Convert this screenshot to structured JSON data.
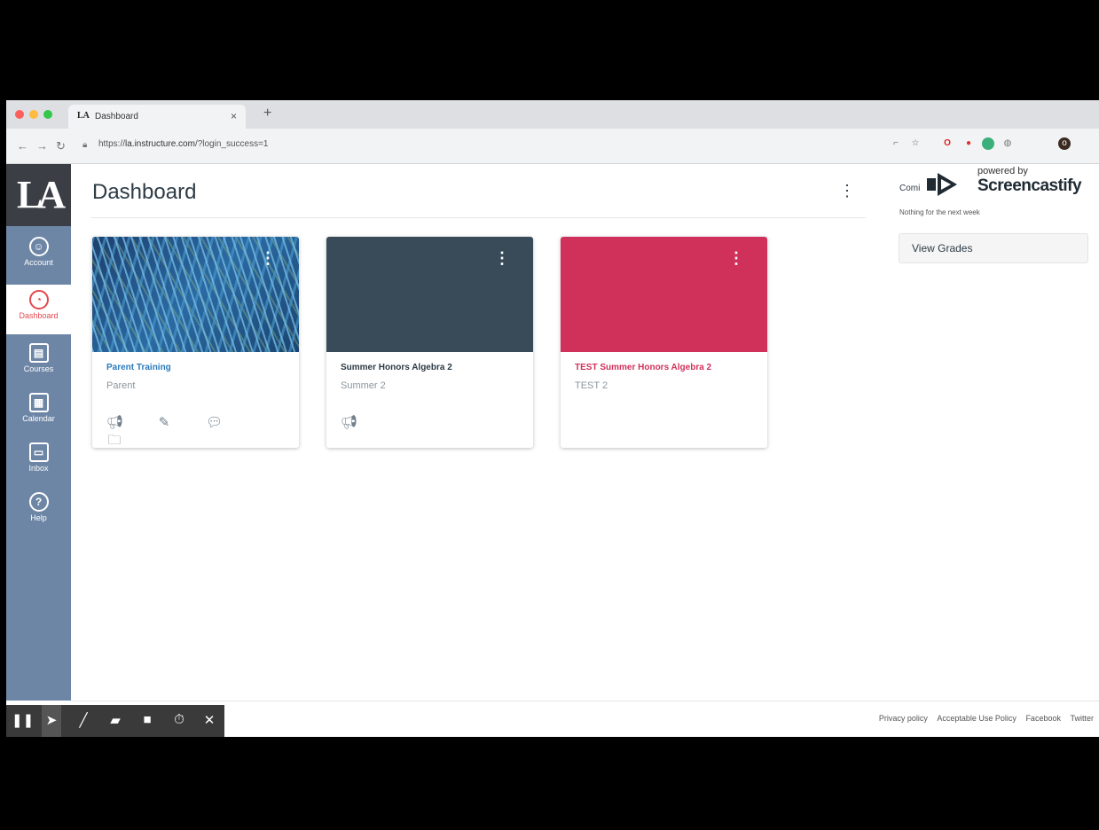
{
  "browser": {
    "tab_title": "Dashboard",
    "tab_favicon": "LA",
    "tab_close": "×",
    "new_tab": "+",
    "url_prefix": "https://",
    "url_host": "la.instructure.com",
    "url_path": "/?login_success=1",
    "nav_icons": [
      "back-icon",
      "forward-icon",
      "reload-icon"
    ]
  },
  "global_nav": {
    "logo": "LA",
    "items": [
      {
        "label": "Account",
        "icon": "account-icon",
        "glyph": "☺"
      },
      {
        "label": "Dashboard",
        "icon": "dashboard-icon",
        "glyph": "◔"
      },
      {
        "label": "Courses",
        "icon": "courses-icon",
        "glyph": "▤"
      },
      {
        "label": "Calendar",
        "icon": "calendar-icon",
        "glyph": "▦"
      },
      {
        "label": "Inbox",
        "icon": "inbox-icon",
        "glyph": "▭"
      },
      {
        "label": "Help",
        "icon": "help-icon",
        "glyph": "?"
      }
    ]
  },
  "main": {
    "title": "Dashboard",
    "cards": [
      {
        "name": "Parent Training",
        "subtitle": "Parent",
        "hero_color": "#2b5b8f",
        "name_color": "#2b7abc"
      },
      {
        "name": "Summer Honors Algebra 2",
        "subtitle": "Summer 2",
        "hero_color": "#394b58",
        "name_color": "#2d3b45"
      },
      {
        "name": "TEST Summer Honors Algebra 2",
        "subtitle": "TEST 2",
        "hero_color": "#d0315b",
        "name_color": "#d0315b"
      }
    ]
  },
  "sidebar": {
    "coming_up": "Comi",
    "nothing": "Nothing for the next week",
    "view_grades": "View Grades"
  },
  "screencastify": {
    "powered_by": "powered by",
    "name": "Screencastify"
  },
  "footer": {
    "links": [
      "Privacy policy",
      "Acceptable Use Policy",
      "Facebook",
      "Twitter"
    ]
  },
  "colors": {
    "nav_bg": "#6e86a6",
    "dashboard_accent": "#e5484d"
  }
}
